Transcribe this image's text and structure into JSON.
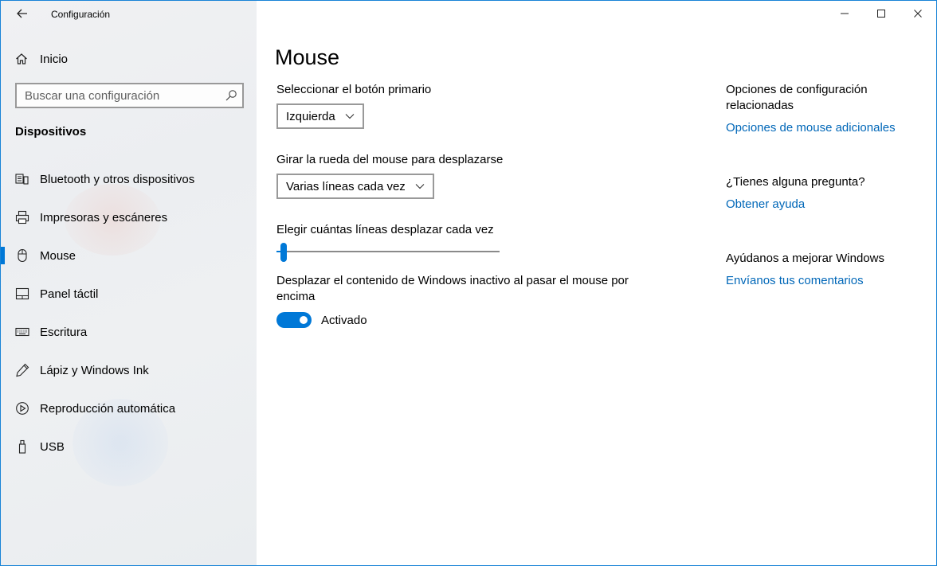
{
  "window": {
    "app_title": "Configuración",
    "accent_color": "#0078d7",
    "link_color": "#0067b8"
  },
  "sidebar": {
    "home_label": "Inicio",
    "search_placeholder": "Buscar una configuración",
    "section_title": "Dispositivos",
    "items": [
      {
        "label": "Bluetooth y otros dispositivos",
        "icon": "bluetooth-device-icon"
      },
      {
        "label": "Impresoras y escáneres",
        "icon": "printer-icon"
      },
      {
        "label": "Mouse",
        "icon": "mouse-icon",
        "selected": true
      },
      {
        "label": "Panel táctil",
        "icon": "touchpad-icon"
      },
      {
        "label": "Escritura",
        "icon": "keyboard-icon"
      },
      {
        "label": "Lápiz y Windows Ink",
        "icon": "pen-icon"
      },
      {
        "label": "Reproducción automática",
        "icon": "autoplay-icon"
      },
      {
        "label": "USB",
        "icon": "usb-icon"
      }
    ]
  },
  "main": {
    "title": "Mouse",
    "primary_button": {
      "label": "Seleccionar el botón primario",
      "value": "Izquierda"
    },
    "scroll_wheel": {
      "label": "Girar la rueda del mouse para desplazarse",
      "value": "Varias líneas cada vez"
    },
    "lines_slider": {
      "label": "Elegir cuántas líneas desplazar cada vez",
      "level": 0.02
    },
    "inactive_scroll": {
      "label_line1": "Desplazar el contenido de Windows inactivo al pasar el mouse por",
      "label_line2": "encima",
      "state_label": "Activado",
      "on": true
    }
  },
  "related": {
    "heading_line1": "Opciones de configuración",
    "heading_line2": "relacionadas",
    "link_mouse": "Opciones de mouse adicionales",
    "question": "¿Tienes alguna pregunta?",
    "link_help": "Obtener ayuda",
    "improve": "Ayúdanos a mejorar Windows",
    "link_feedback": "Envíanos tus comentarios"
  }
}
